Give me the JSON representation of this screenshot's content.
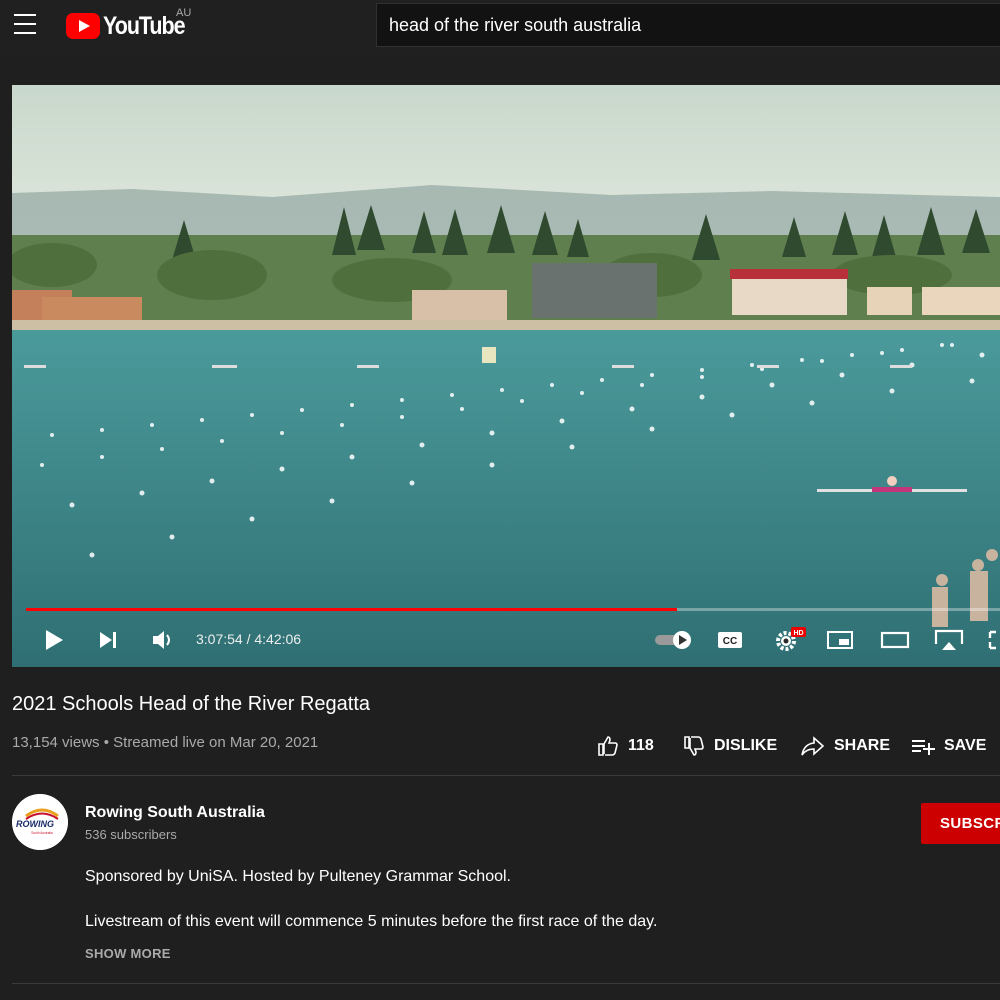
{
  "header": {
    "logo_text": "YouTube",
    "region": "AU",
    "search_value": "head of the river south australia"
  },
  "player": {
    "current_time": "3:07:54",
    "duration": "4:42:06",
    "time_display": "3:07:54 / 4:42:06",
    "progress_fraction": 0.668,
    "settings_badge": "HD",
    "cc_label": "CC"
  },
  "video": {
    "title": "2021 Schools Head of the River Regatta",
    "meta": "13,154 views • Streamed live on Mar 20, 2021",
    "like_count": "118",
    "dislike_label": "DISLIKE",
    "share_label": "SHARE",
    "save_label": "SAVE"
  },
  "channel": {
    "name": "Rowing South Australia",
    "subscribers": "536 subscribers",
    "subscribe_label": "SUBSCRIBE",
    "logo_text": "ROWING",
    "logo_subtext": "South Australia"
  },
  "description": {
    "line1": "Sponsored by UniSA. Hosted by Pulteney Grammar School.",
    "line2": "Livestream of this event will commence 5 minutes before the first race of the day.",
    "show_more": "SHOW MORE"
  },
  "colors": {
    "accent": "#ff0000",
    "subscribe": "#cc0000",
    "background": "#1f1f1f"
  }
}
